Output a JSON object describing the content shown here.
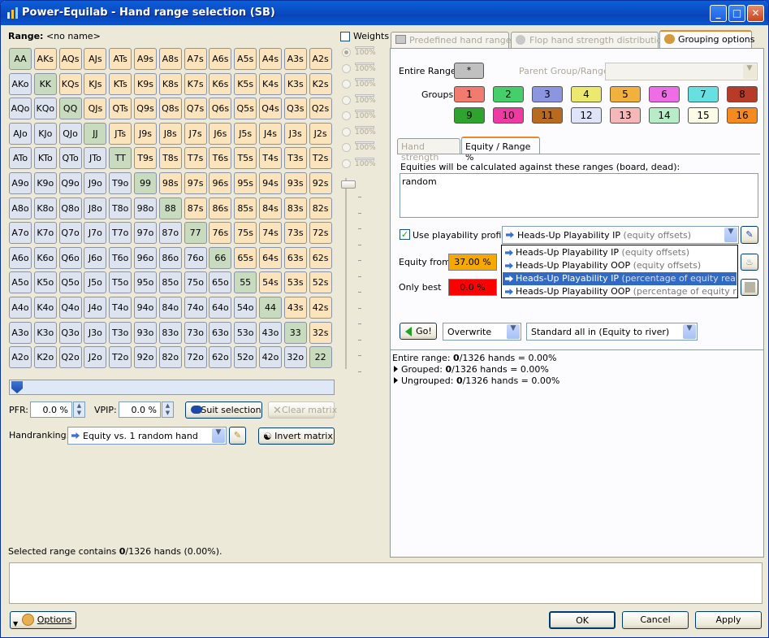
{
  "window": {
    "title": "Power-Equilab - Hand range selection (SB)"
  },
  "range": {
    "label": "Range:",
    "name": "<no name>"
  },
  "matrix": [
    [
      "AA",
      "AKs",
      "AQs",
      "AJs",
      "ATs",
      "A9s",
      "A8s",
      "A7s",
      "A6s",
      "A5s",
      "A4s",
      "A3s",
      "A2s"
    ],
    [
      "AKo",
      "KK",
      "KQs",
      "KJs",
      "KTs",
      "K9s",
      "K8s",
      "K7s",
      "K6s",
      "K5s",
      "K4s",
      "K3s",
      "K2s"
    ],
    [
      "AQo",
      "KQo",
      "QQ",
      "QJs",
      "QTs",
      "Q9s",
      "Q8s",
      "Q7s",
      "Q6s",
      "Q5s",
      "Q4s",
      "Q3s",
      "Q2s"
    ],
    [
      "AJo",
      "KJo",
      "QJo",
      "JJ",
      "JTs",
      "J9s",
      "J8s",
      "J7s",
      "J6s",
      "J5s",
      "J4s",
      "J3s",
      "J2s"
    ],
    [
      "ATo",
      "KTo",
      "QTo",
      "JTo",
      "TT",
      "T9s",
      "T8s",
      "T7s",
      "T6s",
      "T5s",
      "T4s",
      "T3s",
      "T2s"
    ],
    [
      "A9o",
      "K9o",
      "Q9o",
      "J9o",
      "T9o",
      "99",
      "98s",
      "97s",
      "96s",
      "95s",
      "94s",
      "93s",
      "92s"
    ],
    [
      "A8o",
      "K8o",
      "Q8o",
      "J8o",
      "T8o",
      "98o",
      "88",
      "87s",
      "86s",
      "85s",
      "84s",
      "83s",
      "82s"
    ],
    [
      "A7o",
      "K7o",
      "Q7o",
      "J7o",
      "T7o",
      "97o",
      "87o",
      "77",
      "76s",
      "75s",
      "74s",
      "73s",
      "72s"
    ],
    [
      "A6o",
      "K6o",
      "Q6o",
      "J6o",
      "T6o",
      "96o",
      "86o",
      "76o",
      "66",
      "65s",
      "64s",
      "63s",
      "62s"
    ],
    [
      "A5o",
      "K5o",
      "Q5o",
      "J5o",
      "T5o",
      "95o",
      "85o",
      "75o",
      "65o",
      "55",
      "54s",
      "53s",
      "52s"
    ],
    [
      "A4o",
      "K4o",
      "Q4o",
      "J4o",
      "T4o",
      "94o",
      "84o",
      "74o",
      "64o",
      "54o",
      "44",
      "43s",
      "42s"
    ],
    [
      "A3o",
      "K3o",
      "Q3o",
      "J3o",
      "T3o",
      "93o",
      "83o",
      "73o",
      "63o",
      "53o",
      "43o",
      "33",
      "32s"
    ],
    [
      "A2o",
      "K2o",
      "Q2o",
      "J2o",
      "T2o",
      "92o",
      "82o",
      "72o",
      "62o",
      "52o",
      "42o",
      "32o",
      "22"
    ]
  ],
  "weights": {
    "label": "Weights",
    "levels": [
      "100%",
      "100%",
      "100%",
      "100%",
      "100%",
      "100%",
      "100%",
      "100%"
    ],
    "selected_index": 0
  },
  "pfr": {
    "label": "PFR:",
    "value": "0.0 %"
  },
  "vpip": {
    "label": "VPIP:",
    "value": "0.0 %"
  },
  "suit_selection": "Suit selection",
  "clear_matrix": "Clear matrix",
  "handranking": {
    "label": "Handranking:",
    "value": "Equity vs. 1 random hand"
  },
  "invert_matrix": "Invert matrix",
  "selected_status": {
    "prefix": "Selected range contains ",
    "count": "0",
    "suffix": "/1326 hands (0.00%)."
  },
  "tabs": [
    "Predefined hand ranges",
    "Flop hand strength distribution",
    "Grouping options"
  ],
  "active_tab": 2,
  "grouping": {
    "entire_range_label": "Entire Range:",
    "entire_range_value": "*",
    "parent_label": "Parent Group/Range:",
    "groups_label": "Groups:",
    "groups": [
      {
        "label": "1",
        "color": "#f07b6e"
      },
      {
        "label": "2",
        "color": "#45cf6a"
      },
      {
        "label": "3",
        "color": "#8b95e0"
      },
      {
        "label": "4",
        "color": "#ecea6e"
      },
      {
        "label": "5",
        "color": "#f0b13f"
      },
      {
        "label": "6",
        "color": "#ee6de6"
      },
      {
        "label": "7",
        "color": "#66e0e0"
      },
      {
        "label": "8",
        "color": "#b83b28"
      },
      {
        "label": "9",
        "color": "#2ea42e"
      },
      {
        "label": "10",
        "color": "#ee3aa2"
      },
      {
        "label": "11",
        "color": "#b86a1e"
      },
      {
        "label": "12",
        "color": "#dfe4f8"
      },
      {
        "label": "13",
        "color": "#f5b8b8"
      },
      {
        "label": "14",
        "color": "#b8ecc8"
      },
      {
        "label": "15",
        "color": "#fcfce6"
      },
      {
        "label": "16",
        "color": "#f58a1e"
      }
    ]
  },
  "subtabs": [
    "Hand strength",
    "Equity / Range %"
  ],
  "active_subtab": 1,
  "equity": {
    "desc": "Equities will be calculated against these ranges (board, dead):",
    "ranges_text": "random",
    "use_playability_label": "Use playability profile:",
    "use_playability_checked": true,
    "profile_selected": "Heads-Up Playability IP",
    "profile_selected_note": "(equity offsets)",
    "profile_options": [
      {
        "name": "Heads-Up Playability IP",
        "note": "(equity offsets)"
      },
      {
        "name": "Heads-Up Playability OOP",
        "note": "(equity offsets)"
      },
      {
        "name": "Heads-Up Playability IP",
        "note": "(percentage of equity realization)"
      },
      {
        "name": "Heads-Up Playability OOP",
        "note": "(percentage of equity realization)"
      }
    ],
    "highlighted_option": 2,
    "equity_from_label": "Equity from",
    "equity_from_value": "37.00 %",
    "equity_from_color": "#f5a800",
    "only_best_label": "Only best",
    "only_best_value": "0.0 %",
    "only_best_color": "#ff0000"
  },
  "actions": {
    "go": "Go!",
    "mode": "Overwrite",
    "calc": "Standard all in (Equity to river)"
  },
  "summary": {
    "entire": {
      "label": "Entire range: ",
      "count": "0",
      "rest": "/1326 hands = 0.00%"
    },
    "grouped": {
      "label": "Grouped: ",
      "count": "0",
      "rest": "/1326 hands = 0.00%"
    },
    "ungrouped": {
      "label": "Ungrouped: ",
      "count": "0",
      "rest": "/1326 hands = 0.00%"
    }
  },
  "footer": {
    "options": "Options",
    "ok": "OK",
    "cancel": "Cancel",
    "apply": "Apply"
  }
}
